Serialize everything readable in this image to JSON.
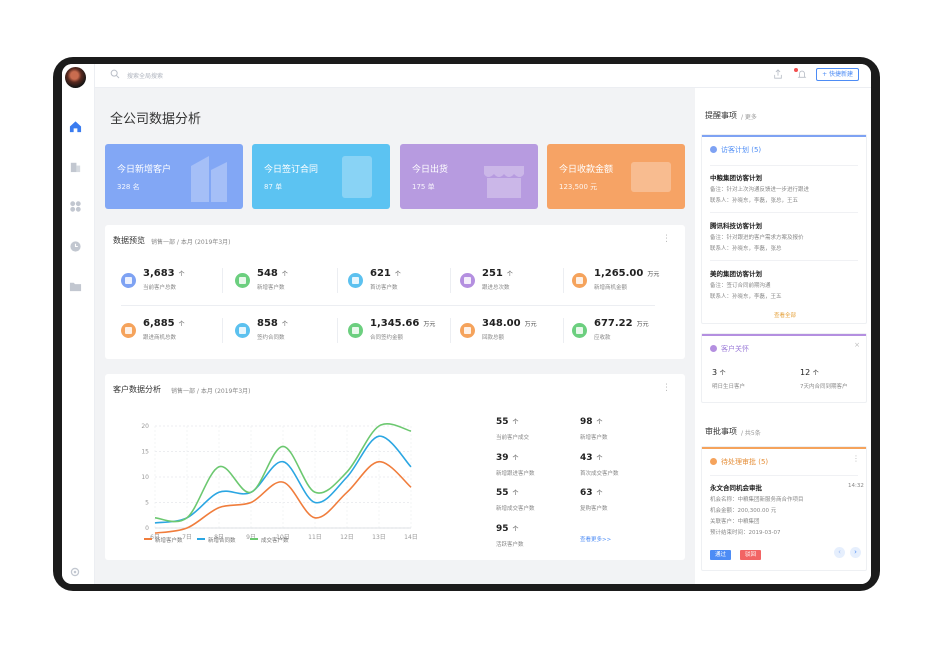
{
  "topbar": {
    "search_placeholder": "搜索全局搜索",
    "quick_btn": "+ 快捷新建"
  },
  "page": {
    "title": "全公司数据分析"
  },
  "cards": [
    {
      "title": "今日新增客户",
      "value": "328 名",
      "color": "#82a7f5"
    },
    {
      "title": "今日签订合同",
      "value": "87 单",
      "color": "#5cc3f2"
    },
    {
      "title": "今日出货",
      "value": "175 单",
      "color": "#b79be0"
    },
    {
      "title": "今日收款金额",
      "value": "123,500 元",
      "color": "#f6a365"
    }
  ],
  "overview": {
    "title": "数据预览",
    "subtitle": "销售一部 / 本月 (2019年3月)",
    "stats": [
      {
        "value": "3,683",
        "unit": "个",
        "label": "当前客户总数",
        "color": "#7ea2f3"
      },
      {
        "value": "548",
        "unit": "个",
        "label": "新增客户数",
        "color": "#6ccf7f"
      },
      {
        "value": "621",
        "unit": "个",
        "label": "首访客户数",
        "color": "#5cc1ef"
      },
      {
        "value": "251",
        "unit": "个",
        "label": "跟进总次数",
        "color": "#b48fe0"
      },
      {
        "value": "1,265.00",
        "unit": "万元",
        "label": "新增商机金额",
        "color": "#f5a35c"
      },
      {
        "value": "6,885",
        "unit": "个",
        "label": "跟进商机总数",
        "color": "#f5a35c"
      },
      {
        "value": "858",
        "unit": "个",
        "label": "签约合同数",
        "color": "#5cc1ef"
      },
      {
        "value": "1,345.66",
        "unit": "万元",
        "label": "合同签约金额",
        "color": "#6ccf7f"
      },
      {
        "value": "348.00",
        "unit": "万元",
        "label": "回款总额",
        "color": "#f5a35c"
      },
      {
        "value": "677.22",
        "unit": "万元",
        "label": "应收款",
        "color": "#6ccf7f"
      }
    ]
  },
  "analysis": {
    "title": "客户数据分析",
    "subtitle": "销售一部 / 本月 (2019年3月)",
    "metrics": [
      {
        "value": "55",
        "unit": "个",
        "label": "当前客户成交"
      },
      {
        "value": "98",
        "unit": "个",
        "label": "新增客户数"
      },
      {
        "value": "39",
        "unit": "个",
        "label": "新增跟进客户数"
      },
      {
        "value": "43",
        "unit": "个",
        "label": "首次成交客户数"
      },
      {
        "value": "55",
        "unit": "个",
        "label": "新增成交客户数"
      },
      {
        "value": "63",
        "unit": "个",
        "label": "复购客户数"
      },
      {
        "value": "95",
        "unit": "个",
        "label": "活跃客户数"
      }
    ],
    "more_link": "查看更多>>"
  },
  "chart_data": {
    "type": "line",
    "x": [
      "6日",
      "7日",
      "8日",
      "9日",
      "10日",
      "11日",
      "12日",
      "13日",
      "14日"
    ],
    "ylim": [
      0,
      20
    ],
    "yticks": [
      "20",
      "15",
      "10",
      "5",
      "0"
    ],
    "series": [
      {
        "name": "新增客户数",
        "color": "#f07d3c",
        "values": [
          -1,
          0,
          4,
          5,
          9,
          2,
          7,
          13,
          8
        ]
      },
      {
        "name": "新增合同数",
        "color": "#2ba6e2",
        "values": [
          1,
          2,
          7,
          7,
          13,
          5,
          10,
          18,
          12
        ]
      },
      {
        "name": "成交客户数",
        "color": "#6cc870",
        "values": [
          2,
          2,
          12,
          7,
          16,
          7,
          11,
          20,
          19
        ]
      }
    ]
  },
  "reminders": {
    "title": "提醒事项",
    "subtitle": "/ 更多",
    "visit_plan": {
      "header": "访客计划 (5)",
      "items": [
        {
          "title": "中粮集团访客计划",
          "lines": [
            "备注：针对上次沟通反馈进一步进行跟进",
            "联系人：孙晓东，李磊，张总，王五"
          ]
        },
        {
          "title": "腾讯科技访客计划",
          "lines": [
            "备注：针对跟进的客户需求方案及报价",
            "联系人：孙晓东，李磊，张总"
          ]
        },
        {
          "title": "美的集团访客计划",
          "lines": [
            "备注：签订合同前期沟通",
            "联系人：孙晓东，李磊，王五"
          ]
        }
      ],
      "view_all": "查看全部"
    },
    "customer_care": {
      "header": "客户关怀",
      "items": [
        {
          "value": "3",
          "unit": "个",
          "label": "明日生日客户"
        },
        {
          "value": "12",
          "unit": "个",
          "label": "7天内合同到期客户"
        }
      ]
    }
  },
  "approvals": {
    "title": "审批事项",
    "subtitle": "/ 共5条",
    "box_header": "待处理审批 (5)",
    "item": {
      "title": "永文合同机会审批",
      "time": "14:32",
      "lines": [
        "机会名称：中粮集团新服务商合作项目",
        "机会金额：200,300.00 元",
        "关联客户：中粮集团",
        "预计结束时间：2019-03-07"
      ]
    },
    "approve_btn": "通过",
    "reject_btn": "驳回"
  }
}
